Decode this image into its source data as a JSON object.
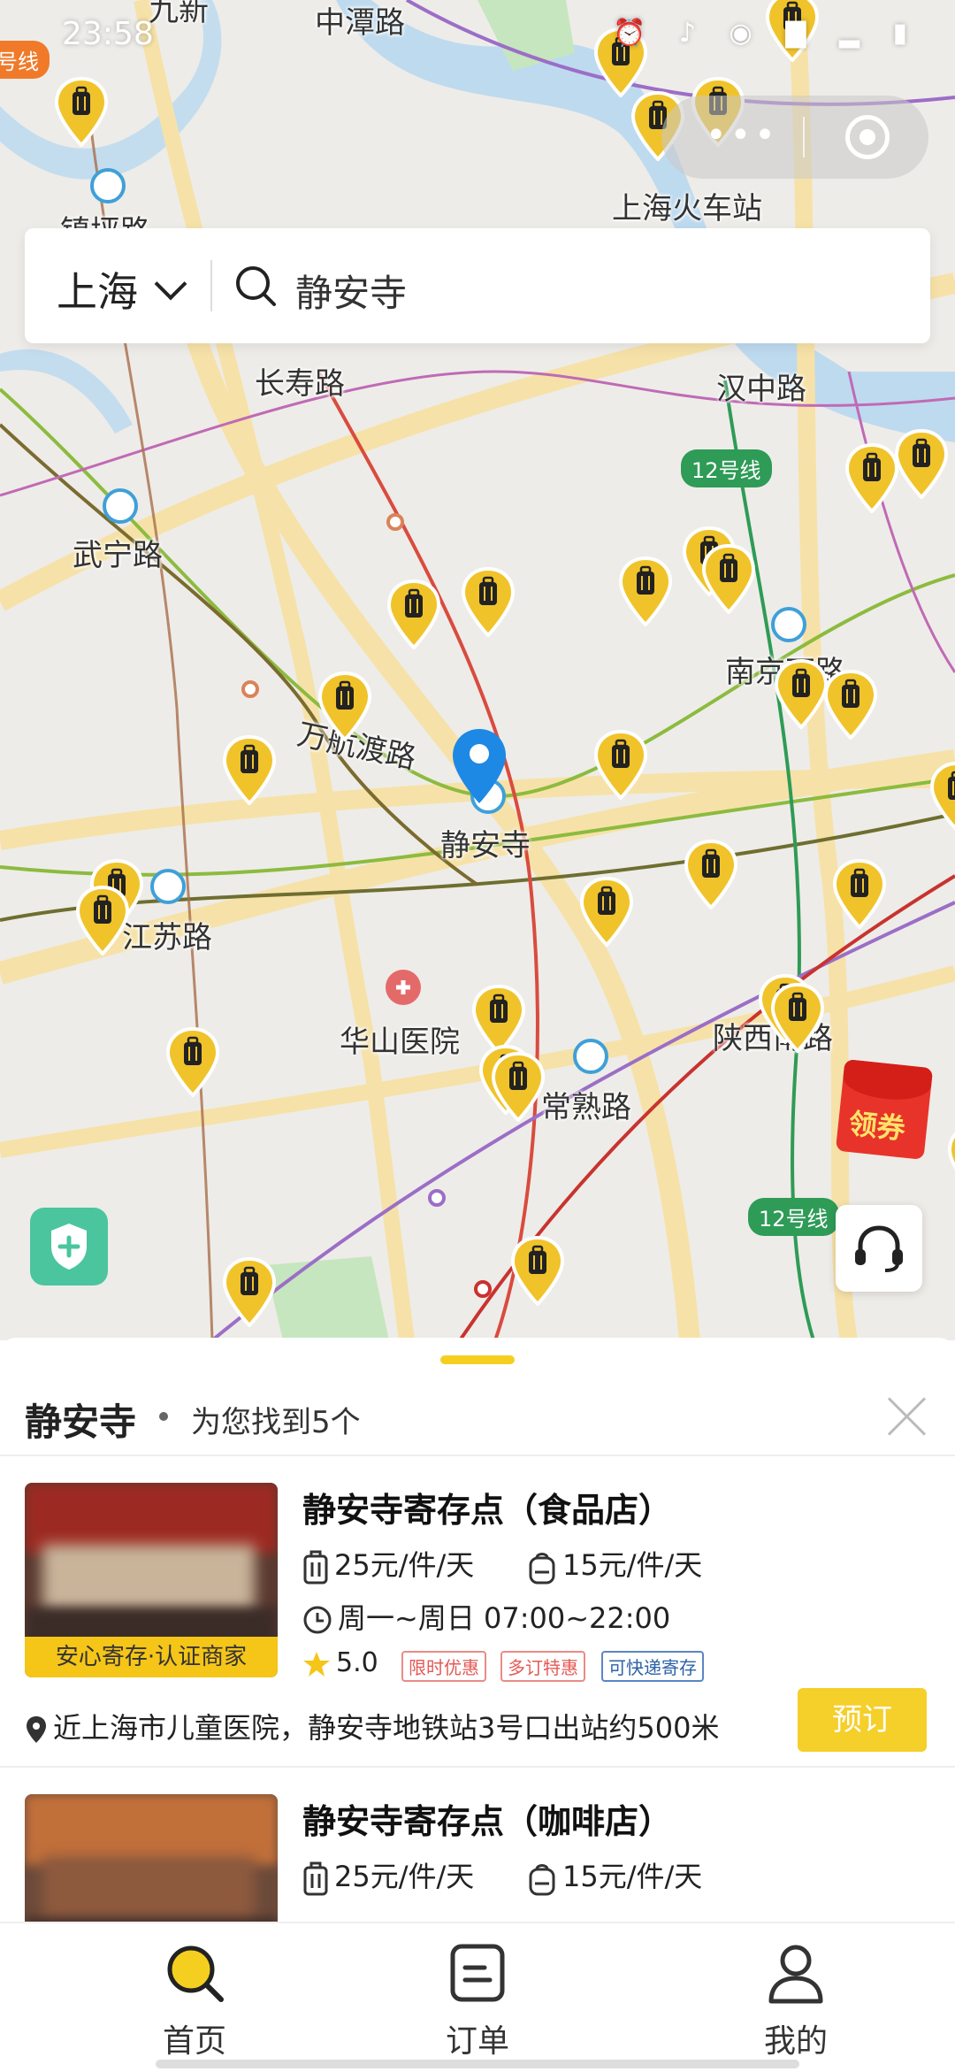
{
  "status_bar": {
    "time": "23:58",
    "icons": "⏰ ♪ ◉ ▇ ▂ ▮"
  },
  "search": {
    "city": "上海",
    "query": "静安寺"
  },
  "map": {
    "labels": [
      "中潭路",
      "上海火车站",
      "长寿路",
      "汉中路",
      "武宁路",
      "南京西路",
      "万航渡路",
      "静安寺",
      "江苏路",
      "华山医院",
      "陕西南路",
      "常熟路",
      "镇坪路",
      "九新"
    ],
    "line_tags": [
      "12号线",
      "12号线"
    ],
    "edge_tag": "号线"
  },
  "coupon": {
    "label": "领券"
  },
  "sheet": {
    "place": "静安寺",
    "found": "为您找到5个",
    "stores": [
      {
        "name": "静安寺寄存点（食品店）",
        "price_large": "25元/件/天",
        "price_small": "15元/件/天",
        "hours": "周一~周日 07:00~22:00",
        "rating": "5.0",
        "tags": [
          "限时优惠",
          "多订特惠",
          "可快递寄存"
        ],
        "cert": "安心寄存·认证商家",
        "address": "近上海市儿童医院，静安寺地铁站3号口出站约500米",
        "book": "预订"
      },
      {
        "name": "静安寺寄存点（咖啡店）",
        "price_large": "25元/件/天",
        "price_small": "15元/件/天"
      }
    ]
  },
  "tabs": [
    {
      "label": "首页",
      "icon": "search-icon",
      "active": true
    },
    {
      "label": "订单",
      "icon": "order-icon",
      "active": false
    },
    {
      "label": "我的",
      "icon": "profile-icon",
      "active": false
    }
  ],
  "colors": {
    "accent": "#f5cf2a",
    "pin": "#f0c32a",
    "location": "#1e88e5"
  }
}
